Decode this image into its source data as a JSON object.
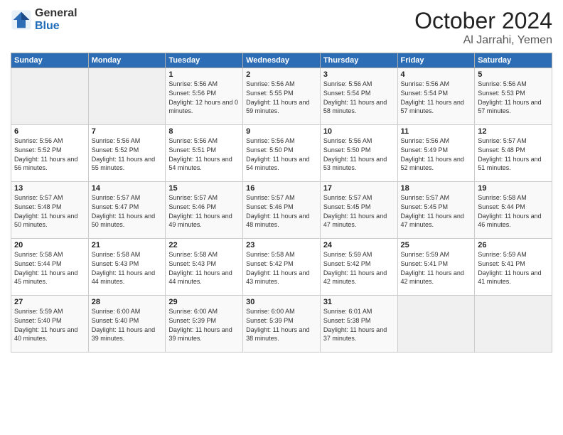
{
  "header": {
    "logo_general": "General",
    "logo_blue": "Blue",
    "month": "October 2024",
    "location": "Al Jarrahi, Yemen"
  },
  "days_of_week": [
    "Sunday",
    "Monday",
    "Tuesday",
    "Wednesday",
    "Thursday",
    "Friday",
    "Saturday"
  ],
  "weeks": [
    [
      {
        "day": "",
        "empty": true
      },
      {
        "day": "",
        "empty": true
      },
      {
        "day": "1",
        "sunrise": "Sunrise: 5:56 AM",
        "sunset": "Sunset: 5:56 PM",
        "daylight": "Daylight: 12 hours and 0 minutes."
      },
      {
        "day": "2",
        "sunrise": "Sunrise: 5:56 AM",
        "sunset": "Sunset: 5:55 PM",
        "daylight": "Daylight: 11 hours and 59 minutes."
      },
      {
        "day": "3",
        "sunrise": "Sunrise: 5:56 AM",
        "sunset": "Sunset: 5:54 PM",
        "daylight": "Daylight: 11 hours and 58 minutes."
      },
      {
        "day": "4",
        "sunrise": "Sunrise: 5:56 AM",
        "sunset": "Sunset: 5:54 PM",
        "daylight": "Daylight: 11 hours and 57 minutes."
      },
      {
        "day": "5",
        "sunrise": "Sunrise: 5:56 AM",
        "sunset": "Sunset: 5:53 PM",
        "daylight": "Daylight: 11 hours and 57 minutes."
      }
    ],
    [
      {
        "day": "6",
        "sunrise": "Sunrise: 5:56 AM",
        "sunset": "Sunset: 5:52 PM",
        "daylight": "Daylight: 11 hours and 56 minutes."
      },
      {
        "day": "7",
        "sunrise": "Sunrise: 5:56 AM",
        "sunset": "Sunset: 5:52 PM",
        "daylight": "Daylight: 11 hours and 55 minutes."
      },
      {
        "day": "8",
        "sunrise": "Sunrise: 5:56 AM",
        "sunset": "Sunset: 5:51 PM",
        "daylight": "Daylight: 11 hours and 54 minutes."
      },
      {
        "day": "9",
        "sunrise": "Sunrise: 5:56 AM",
        "sunset": "Sunset: 5:50 PM",
        "daylight": "Daylight: 11 hours and 54 minutes."
      },
      {
        "day": "10",
        "sunrise": "Sunrise: 5:56 AM",
        "sunset": "Sunset: 5:50 PM",
        "daylight": "Daylight: 11 hours and 53 minutes."
      },
      {
        "day": "11",
        "sunrise": "Sunrise: 5:56 AM",
        "sunset": "Sunset: 5:49 PM",
        "daylight": "Daylight: 11 hours and 52 minutes."
      },
      {
        "day": "12",
        "sunrise": "Sunrise: 5:57 AM",
        "sunset": "Sunset: 5:48 PM",
        "daylight": "Daylight: 11 hours and 51 minutes."
      }
    ],
    [
      {
        "day": "13",
        "sunrise": "Sunrise: 5:57 AM",
        "sunset": "Sunset: 5:48 PM",
        "daylight": "Daylight: 11 hours and 50 minutes."
      },
      {
        "day": "14",
        "sunrise": "Sunrise: 5:57 AM",
        "sunset": "Sunset: 5:47 PM",
        "daylight": "Daylight: 11 hours and 50 minutes."
      },
      {
        "day": "15",
        "sunrise": "Sunrise: 5:57 AM",
        "sunset": "Sunset: 5:46 PM",
        "daylight": "Daylight: 11 hours and 49 minutes."
      },
      {
        "day": "16",
        "sunrise": "Sunrise: 5:57 AM",
        "sunset": "Sunset: 5:46 PM",
        "daylight": "Daylight: 11 hours and 48 minutes."
      },
      {
        "day": "17",
        "sunrise": "Sunrise: 5:57 AM",
        "sunset": "Sunset: 5:45 PM",
        "daylight": "Daylight: 11 hours and 47 minutes."
      },
      {
        "day": "18",
        "sunrise": "Sunrise: 5:57 AM",
        "sunset": "Sunset: 5:45 PM",
        "daylight": "Daylight: 11 hours and 47 minutes."
      },
      {
        "day": "19",
        "sunrise": "Sunrise: 5:58 AM",
        "sunset": "Sunset: 5:44 PM",
        "daylight": "Daylight: 11 hours and 46 minutes."
      }
    ],
    [
      {
        "day": "20",
        "sunrise": "Sunrise: 5:58 AM",
        "sunset": "Sunset: 5:44 PM",
        "daylight": "Daylight: 11 hours and 45 minutes."
      },
      {
        "day": "21",
        "sunrise": "Sunrise: 5:58 AM",
        "sunset": "Sunset: 5:43 PM",
        "daylight": "Daylight: 11 hours and 44 minutes."
      },
      {
        "day": "22",
        "sunrise": "Sunrise: 5:58 AM",
        "sunset": "Sunset: 5:43 PM",
        "daylight": "Daylight: 11 hours and 44 minutes."
      },
      {
        "day": "23",
        "sunrise": "Sunrise: 5:58 AM",
        "sunset": "Sunset: 5:42 PM",
        "daylight": "Daylight: 11 hours and 43 minutes."
      },
      {
        "day": "24",
        "sunrise": "Sunrise: 5:59 AM",
        "sunset": "Sunset: 5:42 PM",
        "daylight": "Daylight: 11 hours and 42 minutes."
      },
      {
        "day": "25",
        "sunrise": "Sunrise: 5:59 AM",
        "sunset": "Sunset: 5:41 PM",
        "daylight": "Daylight: 11 hours and 42 minutes."
      },
      {
        "day": "26",
        "sunrise": "Sunrise: 5:59 AM",
        "sunset": "Sunset: 5:41 PM",
        "daylight": "Daylight: 11 hours and 41 minutes."
      }
    ],
    [
      {
        "day": "27",
        "sunrise": "Sunrise: 5:59 AM",
        "sunset": "Sunset: 5:40 PM",
        "daylight": "Daylight: 11 hours and 40 minutes."
      },
      {
        "day": "28",
        "sunrise": "Sunrise: 6:00 AM",
        "sunset": "Sunset: 5:40 PM",
        "daylight": "Daylight: 11 hours and 39 minutes."
      },
      {
        "day": "29",
        "sunrise": "Sunrise: 6:00 AM",
        "sunset": "Sunset: 5:39 PM",
        "daylight": "Daylight: 11 hours and 39 minutes."
      },
      {
        "day": "30",
        "sunrise": "Sunrise: 6:00 AM",
        "sunset": "Sunset: 5:39 PM",
        "daylight": "Daylight: 11 hours and 38 minutes."
      },
      {
        "day": "31",
        "sunrise": "Sunrise: 6:01 AM",
        "sunset": "Sunset: 5:38 PM",
        "daylight": "Daylight: 11 hours and 37 minutes."
      },
      {
        "day": "",
        "empty": true
      },
      {
        "day": "",
        "empty": true
      }
    ]
  ]
}
